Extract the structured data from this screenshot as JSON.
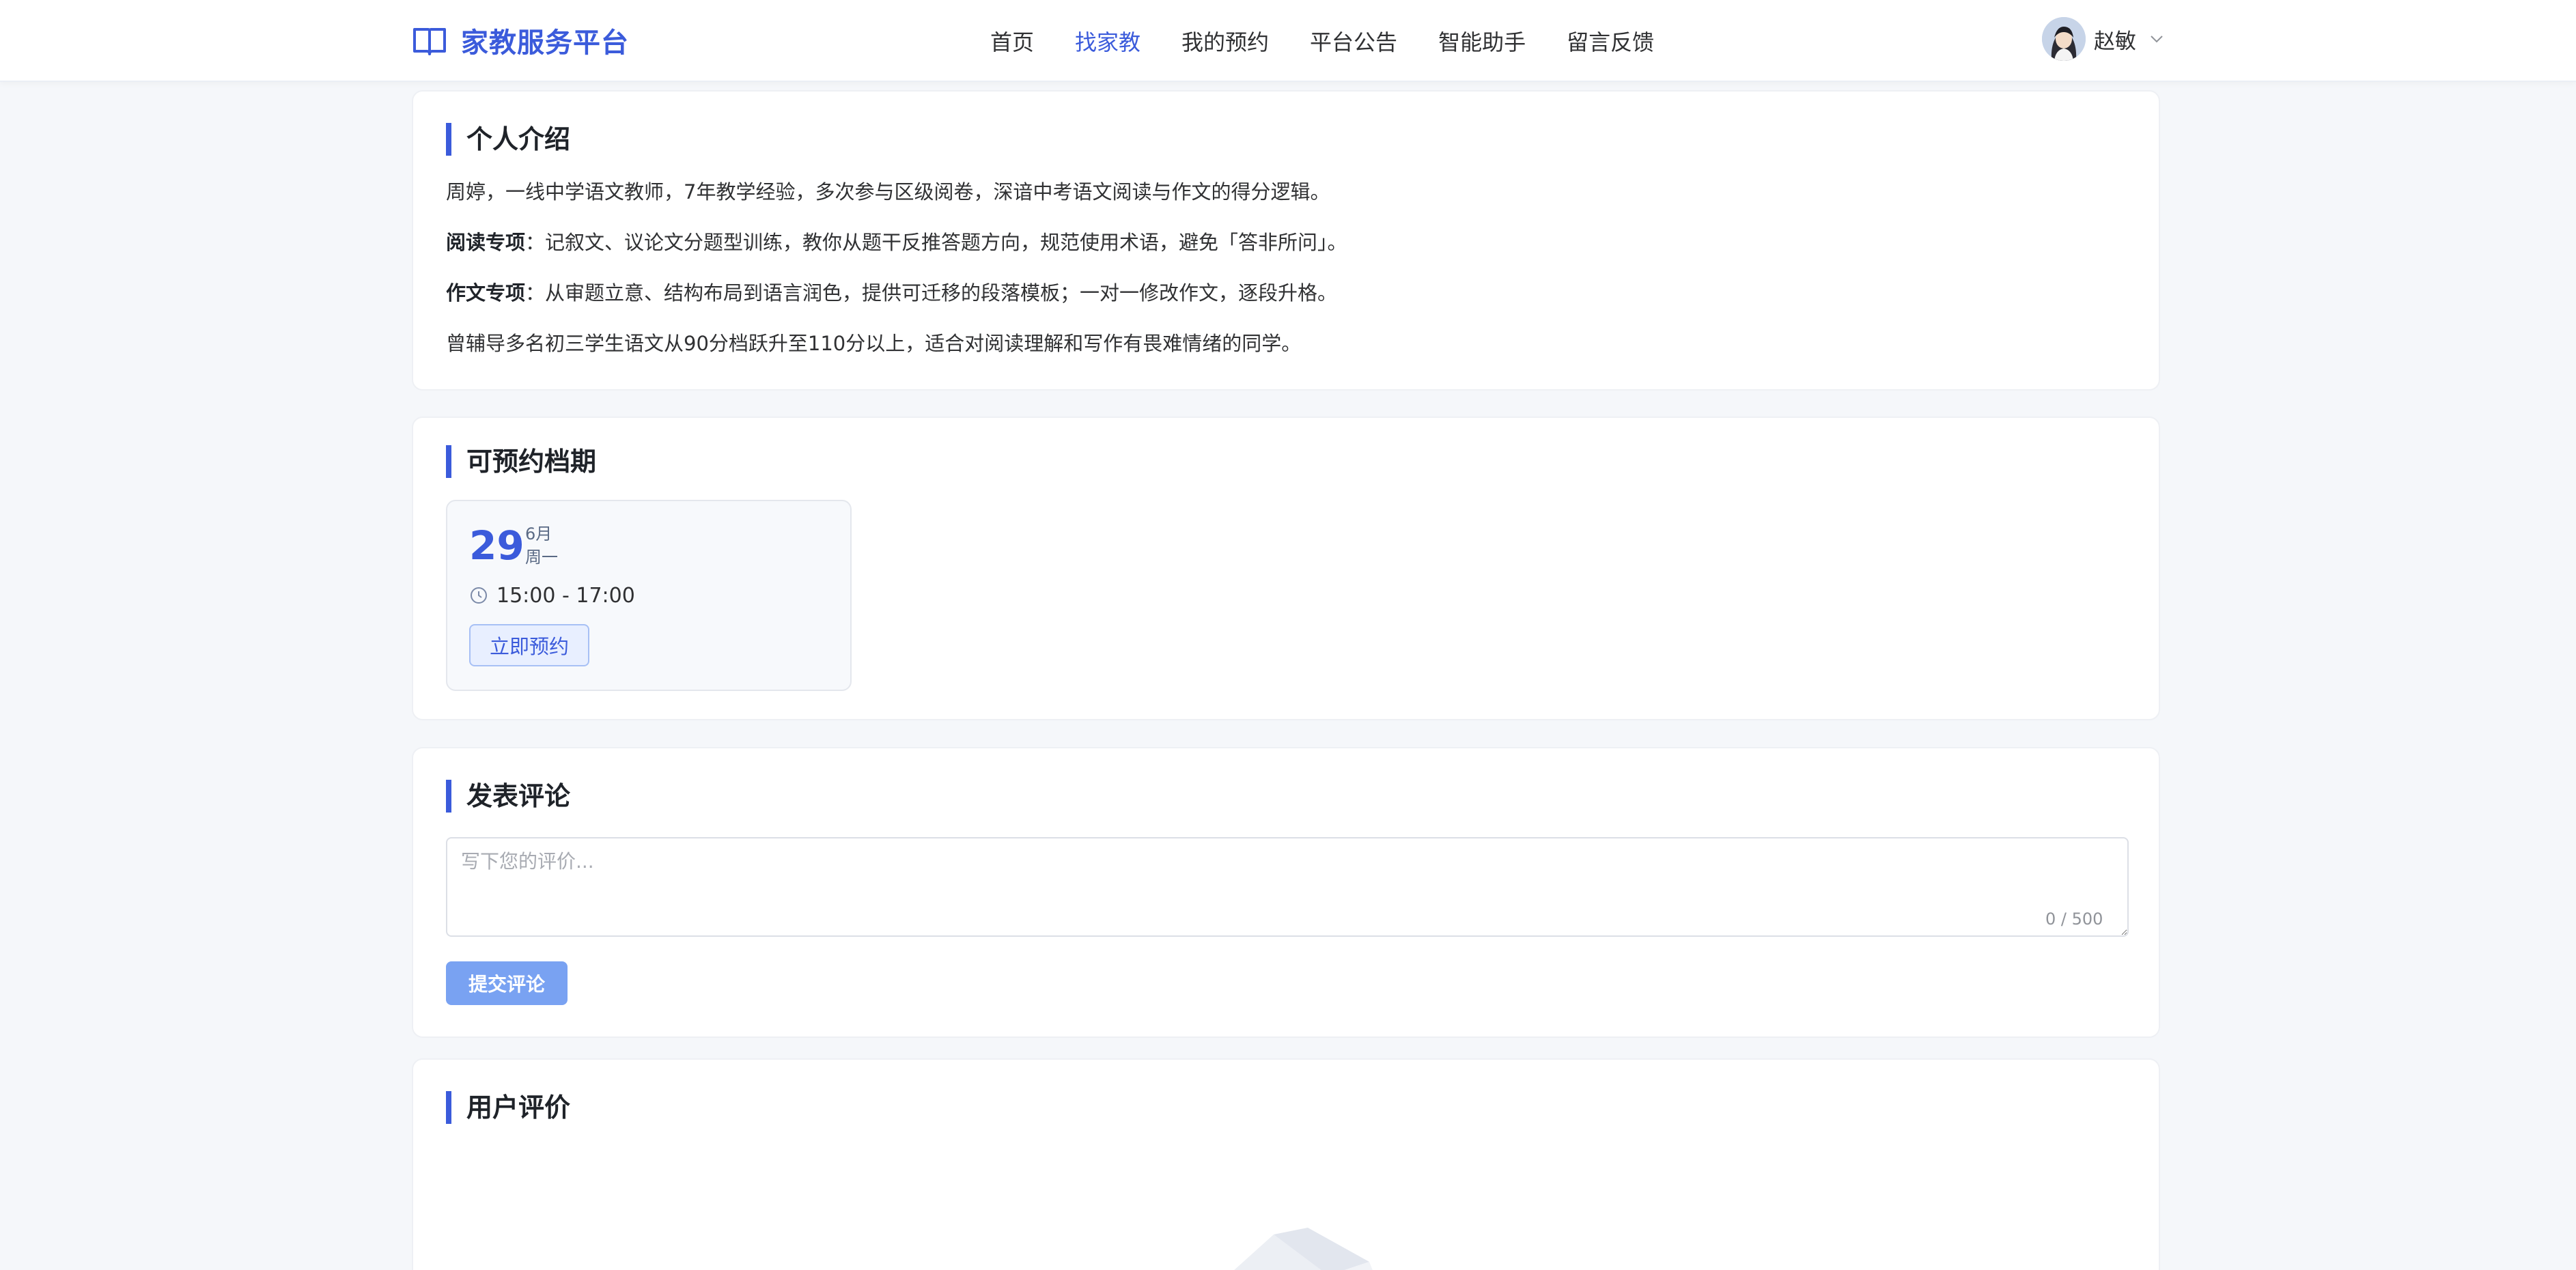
{
  "header": {
    "brand_name": "家教服务平台",
    "nav": [
      {
        "label": "首页",
        "active": false
      },
      {
        "label": "找家教",
        "active": true
      },
      {
        "label": "我的预约",
        "active": false
      },
      {
        "label": "平台公告",
        "active": false
      },
      {
        "label": "智能助手",
        "active": false
      },
      {
        "label": "留言反馈",
        "active": false
      }
    ],
    "user_name": "赵敏"
  },
  "intro": {
    "title": "个人介绍",
    "line1": "周婷，一线中学语文教师，7年教学经验，多次参与区级阅卷，深谙中考语文阅读与作文的得分逻辑。",
    "line2_label": "阅读专项",
    "line2_text": "：记叙文、议论文分题型训练，教你从题干反推答题方向，规范使用术语，避免「答非所问」。",
    "line3_label": "作文专项",
    "line3_text": "：从审题立意、结构布局到语言润色，提供可迁移的段落模板；一对一修改作文，逐段升格。",
    "line4": "曾辅导多名初三学生语文从90分档跃升至110分以上，适合对阅读理解和写作有畏难情绪的同学。"
  },
  "schedule": {
    "title": "可预约档期",
    "slots": [
      {
        "day": "29",
        "month": "6月",
        "weekday": "周一",
        "time": "15:00 - 17:00",
        "button": "立即预约"
      }
    ]
  },
  "comment": {
    "title": "发表评论",
    "placeholder": "写下您的评价...",
    "counter": "0 / 500",
    "submit": "提交评论"
  },
  "reviews": {
    "title": "用户评价"
  },
  "colors": {
    "accent": "#3b5bdb",
    "background": "#f5f7fa",
    "submit_disabled": "#79a2f2"
  },
  "icons": {
    "brand": "book-icon",
    "user_menu": "chevron-down-icon",
    "time": "clock-icon"
  }
}
